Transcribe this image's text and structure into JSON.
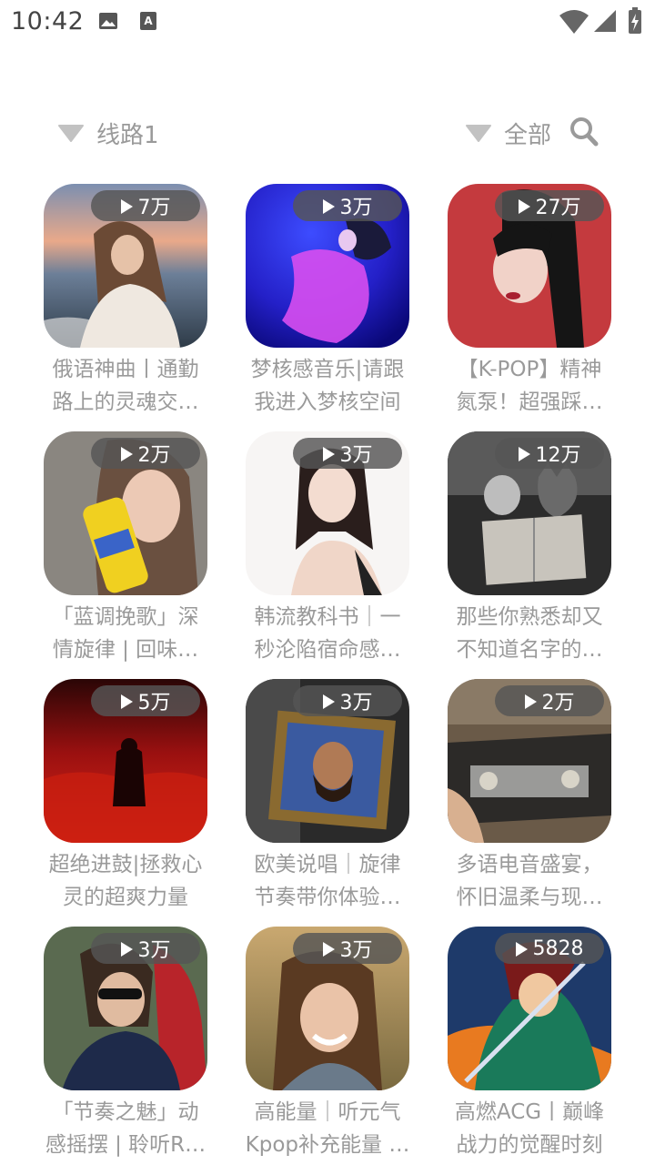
{
  "status_bar": {
    "time": "10:42",
    "icons": [
      "image-icon",
      "a-notification-icon",
      "wifi-icon",
      "cellular-signal-icon",
      "battery-icon"
    ]
  },
  "filter": {
    "route_label": "线路1",
    "category_label": "全部",
    "icons": [
      "dropdown-triangle-icon",
      "search-icon"
    ]
  },
  "playlists": [
    {
      "plays": "7万",
      "title_line1": "俄语神曲丨通勤",
      "title_line2": "路上的灵魂交…"
    },
    {
      "plays": "3万",
      "title_line1": "梦核感音乐|请跟",
      "title_line2": "我进入梦核空间"
    },
    {
      "plays": "27万",
      "title_line1": "【K-POP】精神",
      "title_line2": "氮泵！超强踩…"
    },
    {
      "plays": "2万",
      "title_line1": "「蓝调挽歌」深",
      "title_line2": "情旋律 | 回味…"
    },
    {
      "plays": "3万",
      "title_line1": "韩流教科书｜一",
      "title_line2": "秒沦陷宿命感…"
    },
    {
      "plays": "12万",
      "title_line1": "那些你熟悉却又",
      "title_line2": "不知道名字的…"
    },
    {
      "plays": "5万",
      "title_line1": "超绝进鼓|拯救心",
      "title_line2": "灵的超爽力量"
    },
    {
      "plays": "3万",
      "title_line1": "欧美说唱｜旋律",
      "title_line2": "节奏带你体验…"
    },
    {
      "plays": "2万",
      "title_line1": "多语电音盛宴，",
      "title_line2": "怀旧温柔与现…"
    },
    {
      "plays": "3万",
      "title_line1": "「节奏之魅」动",
      "title_line2": "感摇摆 | 聆听R…"
    },
    {
      "plays": "3万",
      "title_line1": "高能量｜听元气",
      "title_line2": "Kpop补充能量 …"
    },
    {
      "plays": "5828",
      "title_line1": "高燃ACG丨巅峰",
      "title_line2": "战力的觉醒时刻"
    }
  ],
  "colors": {
    "text_secondary": "#9a9a9a",
    "badge_bg": "#555555",
    "background": "#ffffff"
  }
}
